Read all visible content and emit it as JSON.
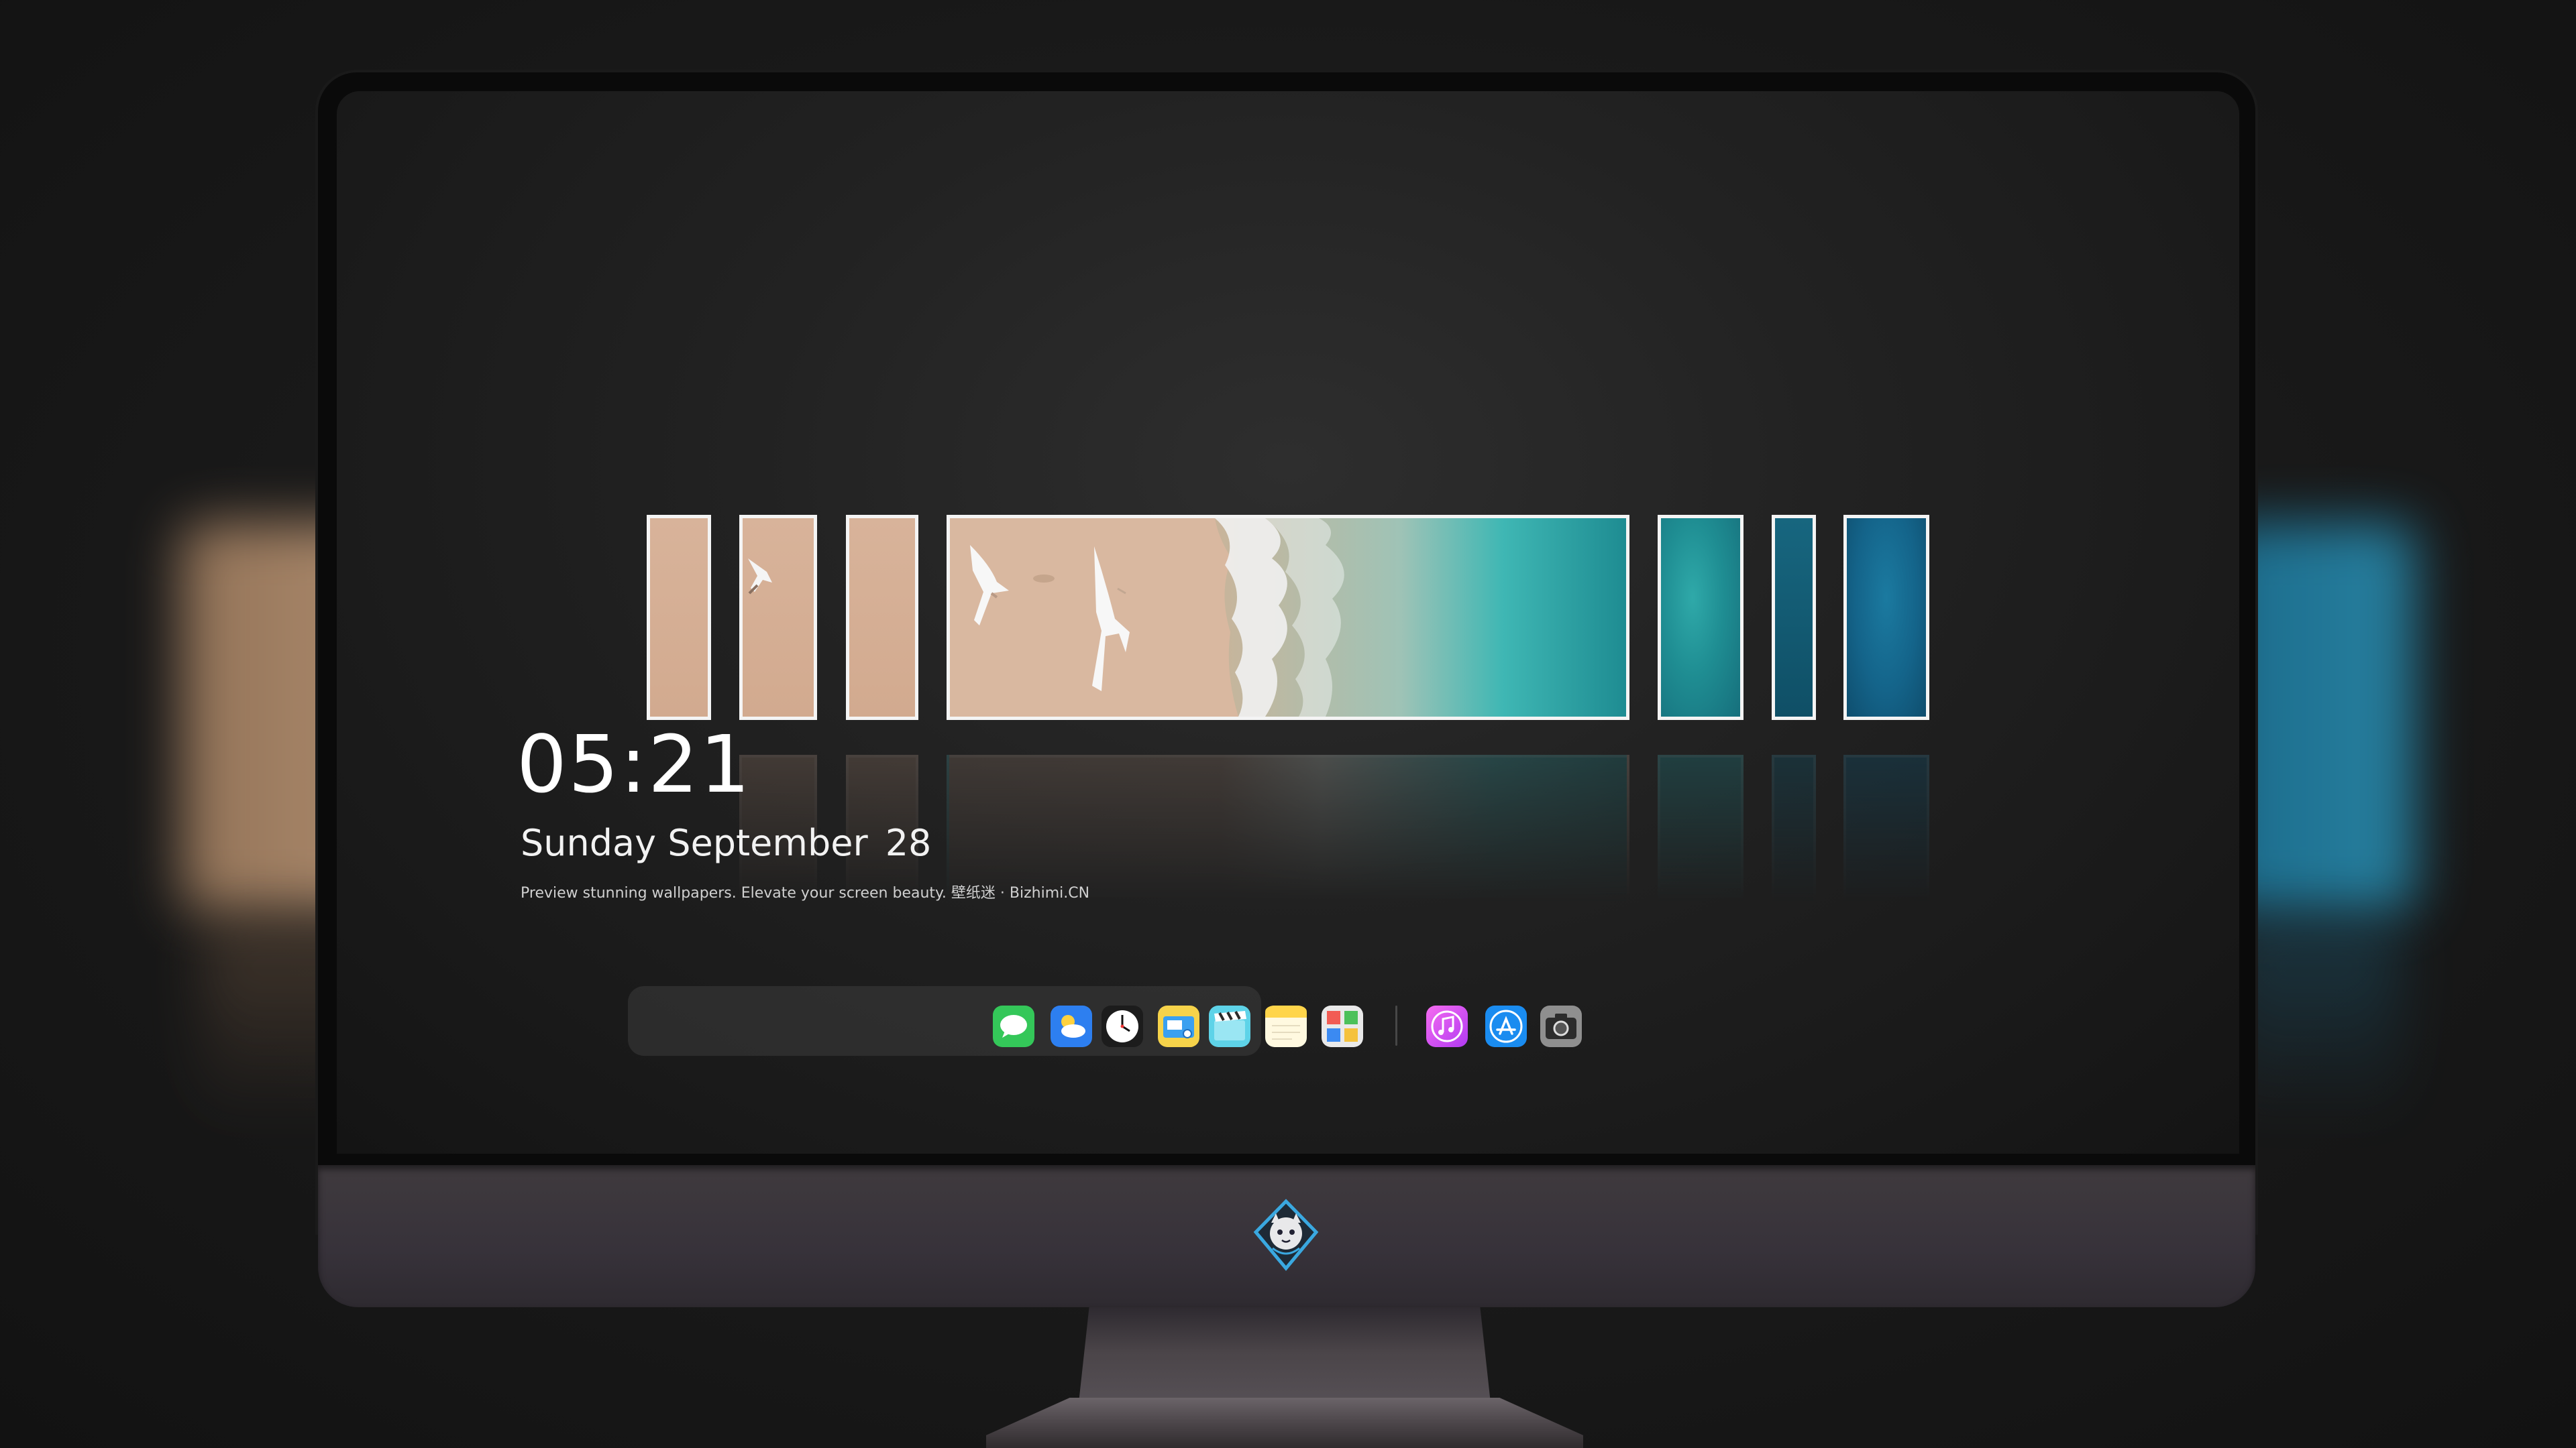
{
  "clock": {
    "time": "05:21",
    "weekday_month": "Sunday September",
    "day": "28",
    "tagline": "Preview stunning wallpapers. Elevate your screen beauty. 壁纸迷 · Bizhimi.CN"
  },
  "gallery": {
    "selected_index": 3,
    "tiles": [
      {
        "scene": "sand"
      },
      {
        "scene": "sand-with-gull"
      },
      {
        "scene": "sand"
      },
      {
        "scene": "beach-with-gulls-and-waves"
      },
      {
        "scene": "turquoise-water"
      },
      {
        "scene": "deep-blue-water"
      },
      {
        "scene": "deep-blue-water"
      }
    ]
  },
  "dock": {
    "apps": [
      {
        "name": "Messages",
        "icon": "messages-icon"
      },
      {
        "name": "Weather",
        "icon": "weather-icon"
      },
      {
        "name": "Clock",
        "icon": "clock-icon"
      },
      {
        "name": "Finder",
        "icon": "finder-icon"
      },
      {
        "name": "Clips",
        "icon": "clapperboard-icon"
      },
      {
        "name": "Notes",
        "icon": "notes-icon"
      },
      {
        "name": "Photo Booth",
        "icon": "photo-grid-icon"
      }
    ],
    "pinned": [
      {
        "name": "Music",
        "icon": "music-icon"
      },
      {
        "name": "App Store",
        "icon": "app-store-icon"
      },
      {
        "name": "Camera",
        "icon": "camera-icon"
      }
    ]
  },
  "colors": {
    "sand": "#d8b39a",
    "turquoise": "#2aa7a8",
    "deep_blue": "#0f5a77",
    "tile_border": "#f4f4f4",
    "chin": "#3d383c"
  }
}
